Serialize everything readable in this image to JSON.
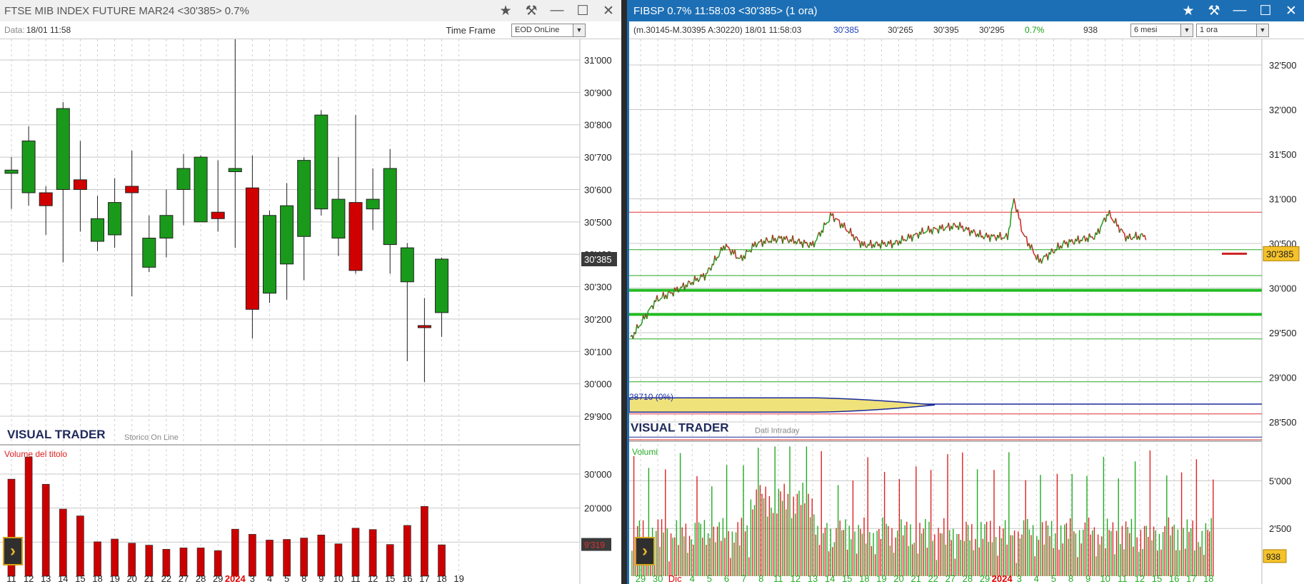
{
  "left": {
    "title": "FTSE MIB INDEX FUTURE MAR24 <30'385> 0.7%",
    "date_label": "Data:",
    "date_value": "18/01 11:58",
    "timeframe_label": "Time Frame",
    "timeframe_value": "EOD OnLine",
    "watermark": "VISUAL TRADER",
    "watermark_sub": "Storico On Line",
    "volume_label": "Volume del titolo",
    "price_badge": "30'385",
    "volume_badge": "9'319",
    "price_ticks": [
      "31'000",
      "30'900",
      "30'800",
      "30'700",
      "30'600",
      "30'500",
      "30'400",
      "30'300",
      "30'200",
      "30'100",
      "30'000",
      "29'900"
    ],
    "volume_ticks": [
      "30'000",
      "20'000",
      "10'000"
    ],
    "x_labels": [
      "11",
      "12",
      "13",
      "14",
      "15",
      "18",
      "19",
      "20",
      "21",
      "22",
      "27",
      "28",
      "29",
      "2024",
      "3",
      "4",
      "5",
      "8",
      "9",
      "10",
      "11",
      "12",
      "15",
      "16",
      "17",
      "18",
      "19"
    ]
  },
  "right": {
    "title": "FIBSP 0.7% 11:58:03  <30'385> (1 ora)",
    "info": "(m.30145-M.30395 A:30220)  18/01 11:58:03",
    "last": "30'385",
    "open": "30'265",
    "high": "30'395",
    "low": "30'295",
    "pct": "0.7%",
    "vol": "938",
    "period": "6 mesi",
    "frame": "1 ora",
    "price_ticks": [
      "32'500",
      "32'000",
      "31'500",
      "31'000",
      "30'500",
      "30'000",
      "29'500",
      "29'000",
      "28'500"
    ],
    "volume_ticks": [
      "5'000",
      "2'500"
    ],
    "price_badge": "30'385",
    "volume_badge": "938",
    "profile_label": "28710 (0%)",
    "watermark": "VISUAL TRADER",
    "watermark_sub": "Dati Intraday",
    "volume_label": "Volumi",
    "x_labels": [
      "29",
      "30",
      "Dic",
      "4",
      "5",
      "6",
      "7",
      "8",
      "11",
      "12",
      "13",
      "14",
      "15",
      "18",
      "19",
      "20",
      "21",
      "22",
      "27",
      "28",
      "29",
      "2024",
      "3",
      "4",
      "5",
      "8",
      "9",
      "10",
      "11",
      "12",
      "15",
      "16",
      "17",
      "18"
    ]
  },
  "chart_data": [
    {
      "type": "candlestick",
      "title": "FTSE MIB INDEX FUTURE MAR24 <30'385> 0.7%",
      "ylim": [
        29870,
        31110
      ],
      "x": [
        "11",
        "12",
        "13",
        "14",
        "15",
        "18",
        "19",
        "20",
        "21",
        "22",
        "27",
        "28",
        "29",
        "2024",
        "3",
        "4",
        "5",
        "8",
        "9",
        "10",
        "11",
        "12",
        "15",
        "16",
        "17",
        "18"
      ],
      "open": [
        30650,
        30590,
        30590,
        30600,
        30630,
        30440,
        30460,
        30610,
        30360,
        30450,
        30600,
        30500,
        30530,
        30655,
        30605,
        30280,
        30370,
        30455,
        30540,
        30450,
        30560,
        30540,
        30430,
        30315,
        30180,
        30220
      ],
      "high": [
        30700,
        30795,
        30610,
        30870,
        30750,
        30580,
        30635,
        30720,
        30520,
        30600,
        30710,
        30705,
        30690,
        31125,
        30705,
        30535,
        30620,
        30700,
        30845,
        30700,
        30830,
        30665,
        30725,
        30435,
        30265,
        30390
      ],
      "low": [
        30540,
        30550,
        30460,
        30375,
        30470,
        30410,
        30420,
        30270,
        30345,
        30390,
        30490,
        30500,
        30470,
        30420,
        30140,
        30250,
        30260,
        30320,
        30520,
        30395,
        30340,
        30475,
        30340,
        30070,
        30005,
        30145
      ],
      "close": [
        30660,
        30750,
        30550,
        30850,
        30600,
        30510,
        30560,
        30590,
        30450,
        30520,
        30665,
        30700,
        30510,
        30665,
        30230,
        30520,
        30550,
        30690,
        30830,
        30570,
        30350,
        30570,
        30665,
        30420,
        30175,
        30385
      ],
      "volume": [
        28500,
        35000,
        27000,
        19700,
        17700,
        10100,
        10900,
        9700,
        9100,
        7900,
        8300,
        8300,
        7500,
        13800,
        12300,
        10600,
        10800,
        11200,
        12100,
        9500,
        14100,
        13700,
        9300,
        14900,
        20500,
        9200
      ],
      "volume_ylim": [
        0,
        36500
      ]
    },
    {
      "type": "line",
      "title": "FIBSP 0.7% 11:58:03  <30'385> (1 ora)",
      "ylim": [
        28300,
        32700
      ],
      "support_resistance": [
        30850,
        30430,
        30140,
        29975,
        29705,
        29430,
        28950
      ],
      "last": 30385,
      "volume_ylim": [
        0,
        7000
      ]
    }
  ]
}
